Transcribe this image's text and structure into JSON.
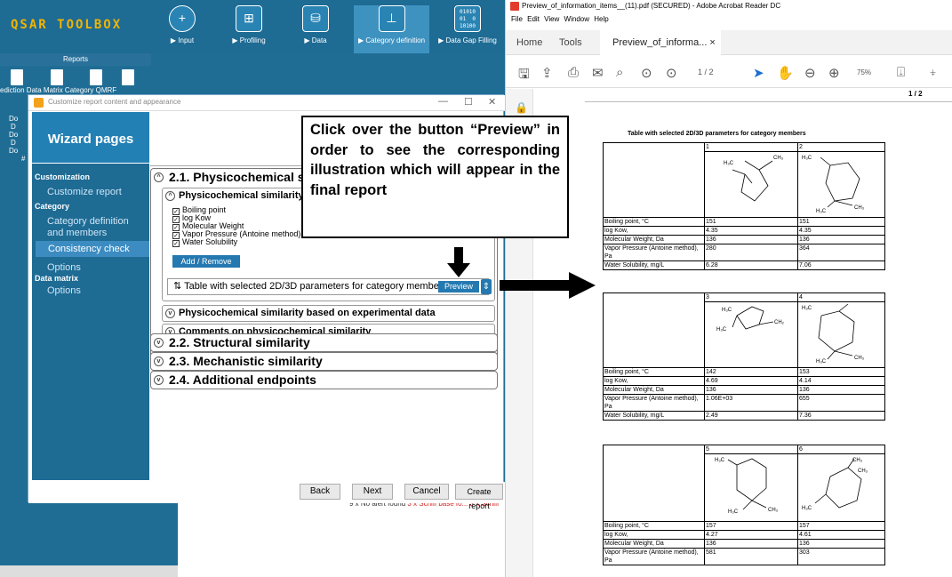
{
  "qsar": {
    "logo": "QSAR TOOLBOX",
    "modules": [
      {
        "label": "▶ Input",
        "icon": "hexagon-plus-icon"
      },
      {
        "label": "▶ Profiling",
        "icon": "grid-icon"
      },
      {
        "label": "▶ Data",
        "icon": "cylinder-icon"
      },
      {
        "label": "▶ Category definition",
        "icon": "hierarchy-icon"
      },
      {
        "label": "▶ Data Gap Filling",
        "icon": "binary-icon",
        "icon_text": "01010\n01  0\n10100"
      }
    ],
    "reports_header": "Reports",
    "report_labels": "ediction Data Matrix  Category   QMRF",
    "tree_items": [
      "Do",
      "D",
      "Do",
      "D",
      "Do",
      "#"
    ],
    "alert_prefix": "9 x No alert found",
    "alert_red": " 3 x Schiff base fo... 3 x Schiff"
  },
  "dialog": {
    "title": "Customize report content and appearance",
    "controls": [
      "—",
      "☐",
      "✕"
    ],
    "wizard_header": "Wizard pages",
    "sidebar": [
      {
        "type": "section",
        "label": "Customization"
      },
      {
        "type": "item",
        "label": "Customize report"
      },
      {
        "type": "section",
        "label": "Category"
      },
      {
        "type": "item",
        "label": "Category definition"
      },
      {
        "type": "item",
        "label": "and members"
      },
      {
        "type": "item",
        "label": "Consistency check",
        "selected": true
      },
      {
        "type": "item",
        "label": "Options"
      },
      {
        "type": "section",
        "label": "Data matrix"
      },
      {
        "type": "item",
        "label": "Options"
      }
    ],
    "sections": {
      "s21": "2.1. Physicochemical sim",
      "sub1": "Physicochemical similarity b",
      "checkboxes": [
        "Boiling point",
        "log Kow",
        "Molecular Weight",
        "Vapor Pressure (Antoine method)",
        "Water Solubility"
      ],
      "add_remove": "Add / Remove",
      "table_row": "⇅ Table with selected 2D/3D parameters for category members",
      "preview": "Preview",
      "sub2": "Physicochemical similarity based on experimental data",
      "sub3": "Comments on physicochemical similarity",
      "s22": "2.2. Structural similarity",
      "s23": "2.3. Mechanistic similarity",
      "s24": "2.4. Additional endpoints"
    },
    "buttons": {
      "back": "Back",
      "next": "Next",
      "cancel": "Cancel",
      "create": "Create report"
    }
  },
  "callout": "Click over the button “Preview” in order to see the corresponding illustration which will appear in the final report",
  "pdf": {
    "title": "Preview_of_information_items__(11).pdf (SECURED) - Adobe Acrobat Reader DC",
    "menu": "File  Edit  View  Window  Help",
    "tabs": {
      "home": "Home",
      "tools": "Tools",
      "doc": "Preview_of_informa...  ×"
    },
    "page_display": "1  / 2",
    "zoom": "75%",
    "page_label": "1 / 2",
    "table_title": "Table with selected 2D/3D parameters for category members",
    "row_labels": [
      "Boiling point, °C",
      "log Kow,",
      "Molecular Weight, Da",
      "Vapor Pressure (Antoine method), Pa",
      "Water Solubility, mg/L"
    ],
    "blocks": [
      {
        "ids": [
          "1",
          "2"
        ],
        "values": [
          [
            "151",
            "151"
          ],
          [
            "4.35",
            "4.35"
          ],
          [
            "136",
            "136"
          ],
          [
            "280",
            "364"
          ],
          [
            "6.28",
            "7.06"
          ]
        ]
      },
      {
        "ids": [
          "3",
          "4"
        ],
        "values": [
          [
            "142",
            "153"
          ],
          [
            "4.69",
            "4.14"
          ],
          [
            "136",
            "136"
          ],
          [
            "1.06E+03",
            "655"
          ],
          [
            "2.49",
            "7.36"
          ]
        ]
      },
      {
        "ids": [
          "5",
          "6"
        ],
        "values": [
          [
            "157",
            "157"
          ],
          [
            "4.27",
            "4.61"
          ],
          [
            "136",
            "136"
          ],
          [
            "581",
            "303"
          ]
        ]
      }
    ],
    "struct_labels": {
      "h3c": "H₃C",
      "ch3": "CH₃",
      "ch2": "CH₂"
    }
  }
}
